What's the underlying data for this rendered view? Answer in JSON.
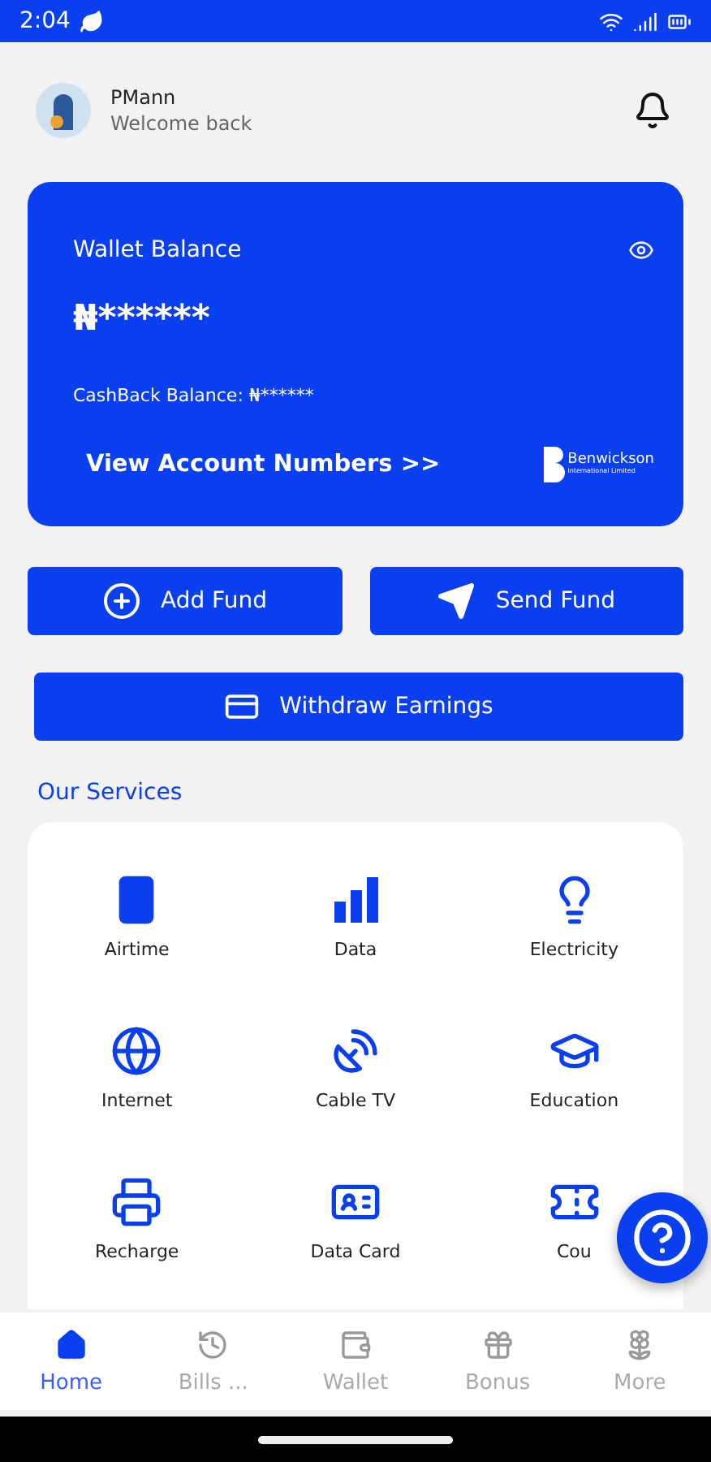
{
  "status_bar": {
    "time": "2:04"
  },
  "header": {
    "name": "PMann",
    "greeting": "Welcome back"
  },
  "balance_card": {
    "title": "Wallet Balance",
    "balance": "₦******",
    "cashback_label": "CashBack Balance:",
    "cashback_value": "₦******",
    "link": "View Account Numbers >>",
    "logo_name": "Benwickson",
    "logo_subtitle": "International Limited"
  },
  "actions": [
    {
      "label": "Add Fund",
      "kind": "add"
    },
    {
      "label": "Send Fund",
      "kind": "send"
    }
  ],
  "withdraw": {
    "label": "Withdraw Earnings"
  },
  "services_title": "Our Services",
  "services": [
    {
      "label": "Airtime",
      "kind": "airtime"
    },
    {
      "label": "Data",
      "kind": "data"
    },
    {
      "label": "Electricity",
      "kind": "electricity"
    },
    {
      "label": "Internet",
      "kind": "internet"
    },
    {
      "label": "Cable TV",
      "kind": "cable"
    },
    {
      "label": "Education",
      "kind": "education"
    },
    {
      "label": "Recharge",
      "kind": "recharge"
    },
    {
      "label": "Data Card",
      "kind": "datacard"
    },
    {
      "label": "Cou",
      "kind": "coupon"
    }
  ],
  "bottom_nav": [
    {
      "label": "Home",
      "kind": "home",
      "selected": true
    },
    {
      "label": "Bills ...",
      "kind": "bills",
      "selected": false
    },
    {
      "label": "Wallet",
      "kind": "wallet",
      "selected": false
    },
    {
      "label": "Bonus",
      "kind": "bonus",
      "selected": false
    },
    {
      "label": "More",
      "kind": "more",
      "selected": false
    }
  ]
}
